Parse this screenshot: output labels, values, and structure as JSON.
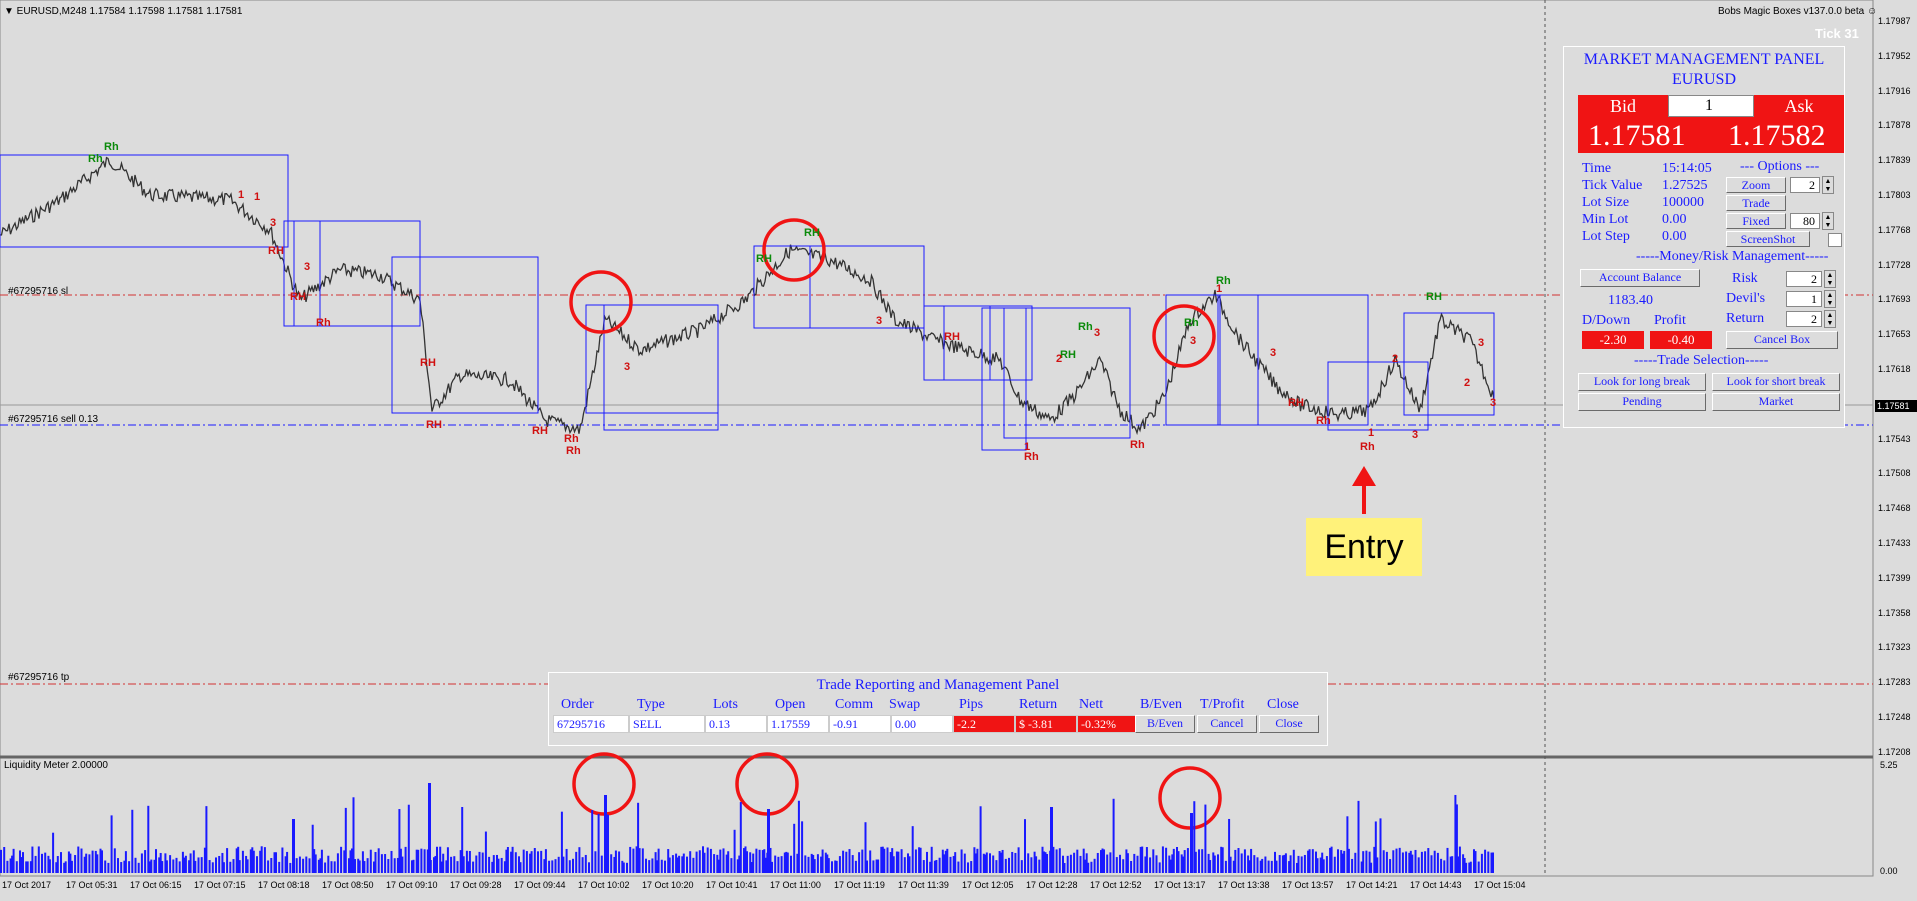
{
  "chart": {
    "header": "▼ EURUSD,M248  1.17584 1.17598 1.17581 1.17581",
    "indicator_name": "Bobs Magic Boxes v137.0.0 beta ☺",
    "tick_label": "Tick 31",
    "price_axis": [
      "1.17987",
      "1.17952",
      "1.17916",
      "1.17878",
      "1.17839",
      "1.17803",
      "1.17768",
      "1.17728",
      "1.17693",
      "1.17653",
      "1.17618",
      "1.17581",
      "1.17543",
      "1.17508",
      "1.17468",
      "1.17433",
      "1.17399",
      "1.17358",
      "1.17323",
      "1.17283",
      "1.17248",
      "1.17208"
    ],
    "current_price_tag": "1.17581",
    "lines": {
      "sl_label": "#67295716 sl",
      "sell_label": "#67295716 sell 0.13",
      "tp_label": "#67295716 tp"
    },
    "time_axis": [
      "17 Oct 2017",
      "17 Oct 05:31",
      "17 Oct 06:15",
      "17 Oct 07:15",
      "17 Oct 08:18",
      "17 Oct 08:50",
      "17 Oct 09:10",
      "17 Oct 09:28",
      "17 Oct 09:44",
      "17 Oct 10:02",
      "17 Oct 10:20",
      "17 Oct 10:41",
      "17 Oct 11:00",
      "17 Oct 11:19",
      "17 Oct 11:39",
      "17 Oct 12:05",
      "17 Oct 12:28",
      "17 Oct 12:52",
      "17 Oct 13:17",
      "17 Oct 13:38",
      "17 Oct 13:57",
      "17 Oct 14:21",
      "17 Oct 14:43",
      "17 Oct 15:04"
    ],
    "liquidity_label": "Liquidity Meter 2.00000",
    "liq_axis_top": "5.25",
    "liq_axis_bottom": "0.00",
    "entry_label": "Entry",
    "markers": [
      "Rh",
      "RH",
      "1",
      "2",
      "3"
    ]
  },
  "mmp": {
    "title": "MARKET MANAGEMENT PANEL",
    "symbol": "EURUSD",
    "bid_label": "Bid",
    "lot_value": "1",
    "ask_label": "Ask",
    "bid": "1.17581",
    "ask": "1.17582",
    "time_label": "Time",
    "time_value": "15:14:05",
    "tick_label": "Tick Value",
    "tick_value": "1.27525",
    "lot_size_label": "Lot Size",
    "lot_size_value": "100000",
    "min_lot_label": "Min Lot",
    "min_lot_value": "0.00",
    "lot_step_label": "Lot Step",
    "lot_step_value": "0.00",
    "options_label": "--- Options ---",
    "zoom_btn": "Zoom",
    "zoom_value": "2",
    "trade_btn": "Trade",
    "fixed_btn": "Fixed",
    "fixed_value": "80",
    "screenshot_btn": "ScreenShot",
    "money_header": "-----Money/Risk Management-----",
    "account_balance_btn": "Account Balance",
    "balance_value": "1183.40",
    "risk_label": "Risk",
    "risk_value": "2",
    "devils_label": "Devil's",
    "devils_value": "1",
    "return_label": "Return",
    "return_value": "2",
    "ddown_label": "D/Down",
    "profit_label": "Profit",
    "ddown_value": "-2.30",
    "profit_value": "-0.40",
    "cancel_box_btn": "Cancel Box",
    "trade_selection_header": "-----Trade Selection-----",
    "long_btn": "Look for long break",
    "short_btn": "Look for short break",
    "pending_btn": "Pending",
    "market_btn": "Market"
  },
  "trp": {
    "title": "Trade Reporting and Management Panel",
    "headers": [
      "Order",
      "Type",
      "Lots",
      "Open",
      "Comm",
      "Swap",
      "Pips",
      "Return",
      "Nett",
      "B/Even",
      "T/Profit",
      "Close"
    ],
    "row": {
      "order": "67295716",
      "type": "SELL",
      "lots": "0.13",
      "open": "1.17559",
      "comm": "-0.91",
      "swap": "0.00",
      "pips": "-2.2",
      "ret": "$ -3.81",
      "nett": "-0.32%"
    },
    "beven_btn": "B/Even",
    "cancel_btn": "Cancel",
    "close_btn": "Close"
  }
}
